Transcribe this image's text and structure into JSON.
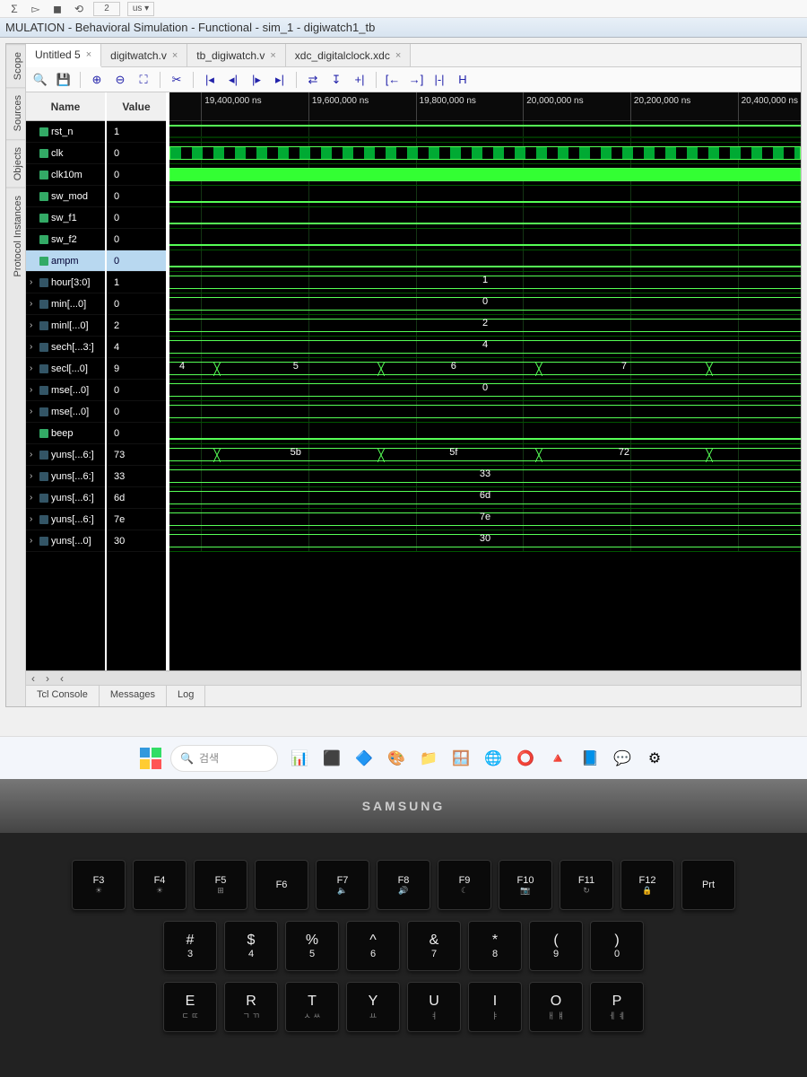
{
  "window": {
    "title": "MULATION - Behavioral Simulation - Functional - sim_1 - digiwatch1_tb"
  },
  "side_tabs": [
    "Scope",
    "Sources",
    "Objects",
    "Protocol Instances"
  ],
  "file_tabs": [
    {
      "label": "Untitled 5",
      "active": true
    },
    {
      "label": "digitwatch.v",
      "active": false
    },
    {
      "label": "tb_digiwatch.v",
      "active": false
    },
    {
      "label": "xdc_digitalclock.xdc",
      "active": false
    }
  ],
  "headers": {
    "name": "Name",
    "value": "Value"
  },
  "time_ticks": [
    "19,400,000 ns",
    "19,600,000 ns",
    "19,800,000 ns",
    "20,000,000 ns",
    "20,200,000 ns",
    "20,400,000 ns"
  ],
  "signals": [
    {
      "name": "rst_n",
      "value": "1",
      "type": "high",
      "expand": false
    },
    {
      "name": "clk",
      "value": "0",
      "type": "clk",
      "expand": false
    },
    {
      "name": "clk10m",
      "value": "0",
      "type": "solidhigh",
      "expand": false
    },
    {
      "name": "sw_mod",
      "value": "0",
      "type": "low",
      "expand": false
    },
    {
      "name": "sw_f1",
      "value": "0",
      "type": "low",
      "expand": false
    },
    {
      "name": "sw_f2",
      "value": "0",
      "type": "low",
      "expand": false
    },
    {
      "name": "ampm",
      "value": "0",
      "type": "low",
      "expand": false,
      "selected": true
    },
    {
      "name": "hour[3:0]",
      "value": "1",
      "type": "bus",
      "expand": true,
      "labels": [
        {
          "pos": 50,
          "text": "1"
        }
      ]
    },
    {
      "name": "min[...0]",
      "value": "0",
      "type": "bus",
      "expand": true,
      "labels": [
        {
          "pos": 50,
          "text": "0"
        }
      ]
    },
    {
      "name": "minl[...0]",
      "value": "2",
      "type": "bus",
      "expand": true,
      "labels": [
        {
          "pos": 50,
          "text": "2"
        }
      ]
    },
    {
      "name": "sech[...3:]",
      "value": "4",
      "type": "bus",
      "expand": true,
      "labels": [
        {
          "pos": 50,
          "text": "4"
        }
      ]
    },
    {
      "name": "secl[...0]",
      "value": "9",
      "type": "bus",
      "expand": true,
      "labels": [
        {
          "pos": 2,
          "text": "4"
        },
        {
          "pos": 20,
          "text": "5"
        },
        {
          "pos": 45,
          "text": "6"
        },
        {
          "pos": 72,
          "text": "7"
        }
      ],
      "transitions": [
        7,
        33,
        58,
        85
      ]
    },
    {
      "name": "mse[...0]",
      "value": "0",
      "type": "bus",
      "expand": true,
      "labels": [
        {
          "pos": 50,
          "text": "0"
        }
      ]
    },
    {
      "name": "mse[...0]",
      "value": "0",
      "type": "bus",
      "expand": true
    },
    {
      "name": "beep",
      "value": "0",
      "type": "low",
      "expand": false
    },
    {
      "name": "yuns[...6:]",
      "value": "73",
      "type": "bus",
      "expand": true,
      "labels": [
        {
          "pos": 20,
          "text": "5b"
        },
        {
          "pos": 45,
          "text": "5f"
        },
        {
          "pos": 72,
          "text": "72"
        }
      ],
      "transitions": [
        7,
        33,
        58,
        85
      ]
    },
    {
      "name": "yuns[...6:]",
      "value": "33",
      "type": "bus",
      "expand": true,
      "labels": [
        {
          "pos": 50,
          "text": "33"
        }
      ]
    },
    {
      "name": "yuns[...6:]",
      "value": "6d",
      "type": "bus",
      "expand": true,
      "labels": [
        {
          "pos": 50,
          "text": "6d"
        }
      ]
    },
    {
      "name": "yuns[...6:]",
      "value": "7e",
      "type": "bus",
      "expand": true,
      "labels": [
        {
          "pos": 50,
          "text": "7e"
        }
      ]
    },
    {
      "name": "yuns[...0]",
      "value": "30",
      "type": "bus",
      "expand": true,
      "labels": [
        {
          "pos": 50,
          "text": "30"
        }
      ]
    }
  ],
  "bottom_tabs": [
    "Tcl Console",
    "Messages",
    "Log"
  ],
  "taskbar": {
    "search_placeholder": "검색",
    "icons": [
      "📊",
      "⬛",
      "🔷",
      "🎨",
      "📁",
      "🪟",
      "🌐",
      "⭕",
      "🔺",
      "📘",
      "💬",
      "⚙"
    ]
  },
  "laptop_brand": "SAMSUNG",
  "keyboard": {
    "frow": [
      {
        "k": "F3",
        "s": "☀"
      },
      {
        "k": "F4",
        "s": "☀"
      },
      {
        "k": "F5",
        "s": "⊞"
      },
      {
        "k": "F6",
        "s": ""
      },
      {
        "k": "F7",
        "s": "🔈"
      },
      {
        "k": "F8",
        "s": "🔊"
      },
      {
        "k": "F9",
        "s": "☾"
      },
      {
        "k": "F10",
        "s": "📷"
      },
      {
        "k": "F11",
        "s": "↻"
      },
      {
        "k": "F12",
        "s": "🔒"
      },
      {
        "k": "Prt",
        "s": ""
      }
    ],
    "numrow": [
      {
        "m": "#",
        "s": "3"
      },
      {
        "m": "$",
        "s": "4"
      },
      {
        "m": "%",
        "s": "5"
      },
      {
        "m": "^",
        "s": "6"
      },
      {
        "m": "&",
        "s": "7"
      },
      {
        "m": "*",
        "s": "8"
      },
      {
        "m": "(",
        "s": "9"
      },
      {
        "m": ")",
        "s": "0"
      }
    ],
    "qrow": [
      {
        "m": "E",
        "s": "ㄷ ㄸ"
      },
      {
        "m": "R",
        "s": "ㄱ ㄲ"
      },
      {
        "m": "T",
        "s": "ㅅ ㅆ"
      },
      {
        "m": "Y",
        "s": "ㅛ"
      },
      {
        "m": "U",
        "s": "ㅕ"
      },
      {
        "m": "I",
        "s": "ㅑ"
      },
      {
        "m": "O",
        "s": "ㅐ ㅒ"
      },
      {
        "m": "P",
        "s": "ㅔ ㅖ"
      }
    ]
  }
}
